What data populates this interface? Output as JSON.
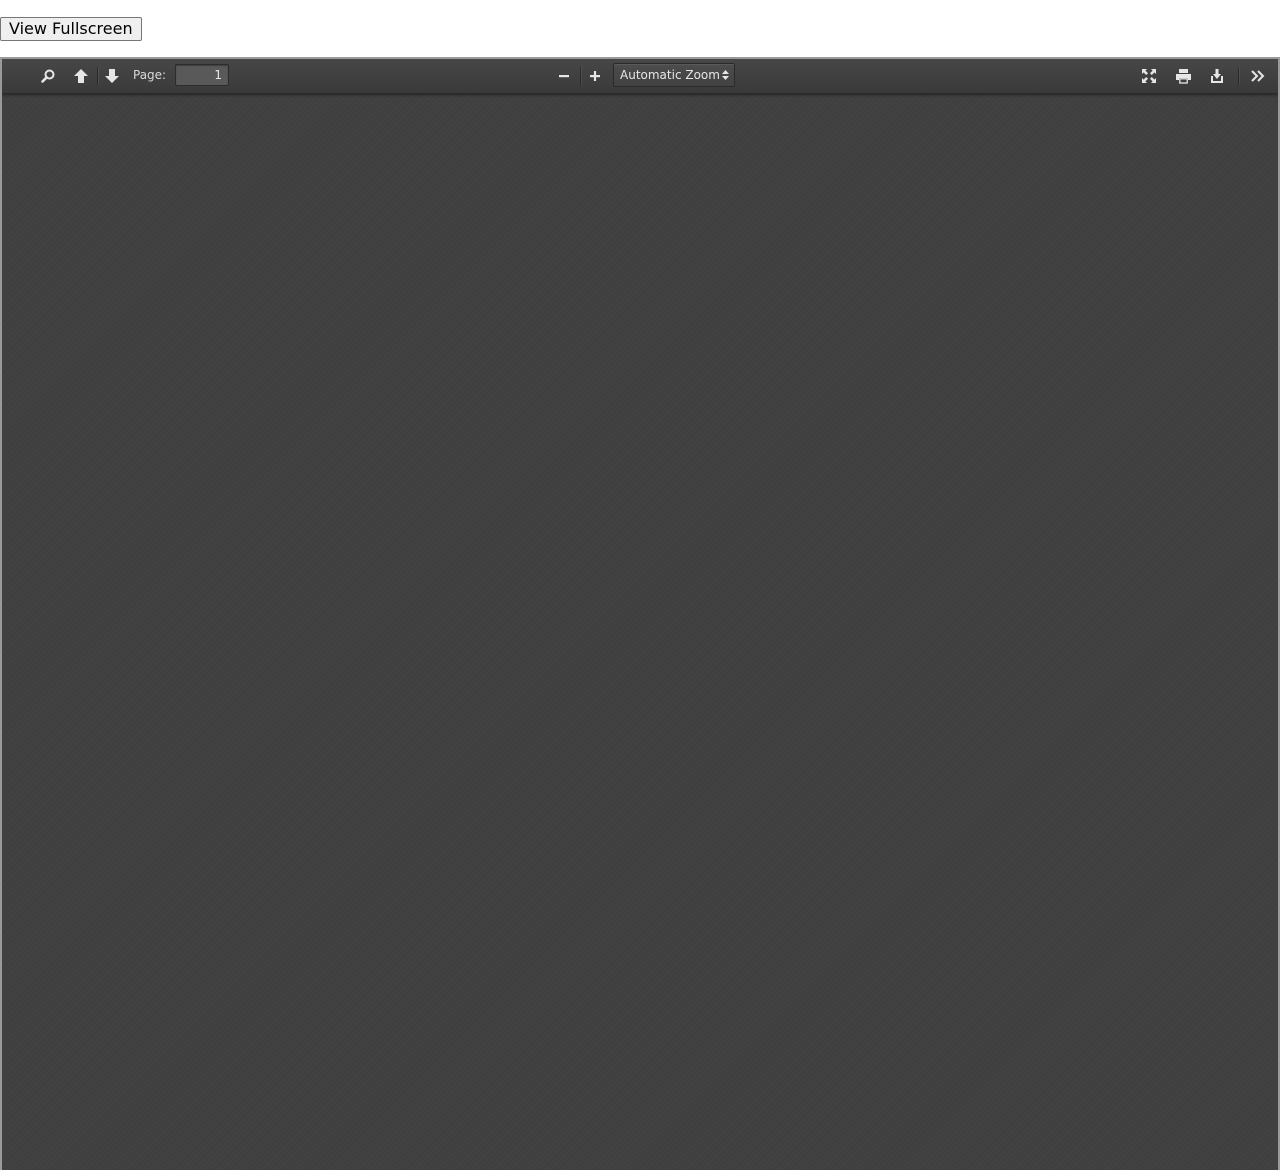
{
  "fullscreen_button": {
    "label": "View Fullscreen"
  },
  "viewer": {
    "background": "#404040",
    "toolbar": {
      "page_label": "Page:",
      "page_number": "1",
      "zoom": {
        "selected": "Automatic Zoom"
      },
      "icons": {
        "search": "search-icon",
        "previous": "arrow-up-icon",
        "next": "arrow-down-icon",
        "zoom_out": "minus-icon",
        "zoom_in": "plus-icon",
        "presentation": "fullscreen-icon",
        "print": "print-icon",
        "download": "download-icon",
        "tools": "double-chevron-right-icon"
      }
    }
  }
}
